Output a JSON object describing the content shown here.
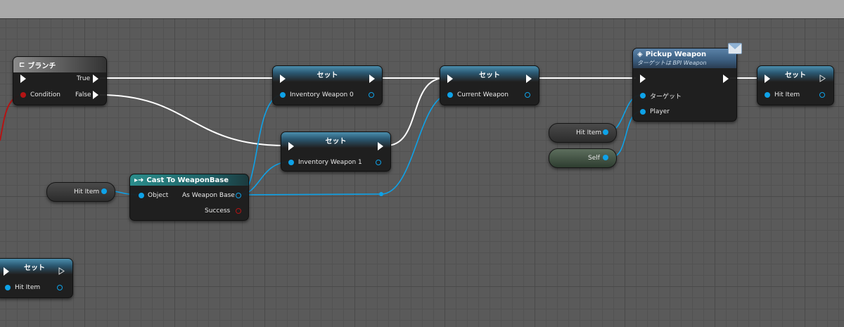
{
  "colors": {
    "exec": "#ffffff",
    "object": "#0ea2e8",
    "bool": "#b41414"
  },
  "nodes": {
    "branch": {
      "title": "ブランチ",
      "pins": {
        "true": "True",
        "condition": "Condition",
        "false": "False"
      }
    },
    "set1": {
      "title": "セット",
      "var": "Inventory Weapon 0"
    },
    "set2": {
      "title": "セット",
      "var": "Current Weapon"
    },
    "set3": {
      "title": "セット",
      "var": "Inventory Weapon 1"
    },
    "cast": {
      "title": "Cast To WeaponBase",
      "pins": {
        "object": "Object",
        "as": "As Weapon Base",
        "success": "Success"
      }
    },
    "pickup": {
      "title": "Pickup Weapon",
      "subtitle": "ターゲットは BPI Weapon",
      "pins": {
        "target": "ターゲット",
        "player": "Player"
      },
      "icon": "envelope-icon"
    },
    "set4": {
      "title": "セット",
      "var": "Hit Item"
    },
    "set5": {
      "title": "セット",
      "var": "Hit Item"
    }
  },
  "getters": {
    "hit_item_a": "Hit Item",
    "hit_item_b": "Hit Item",
    "self": "Self"
  }
}
